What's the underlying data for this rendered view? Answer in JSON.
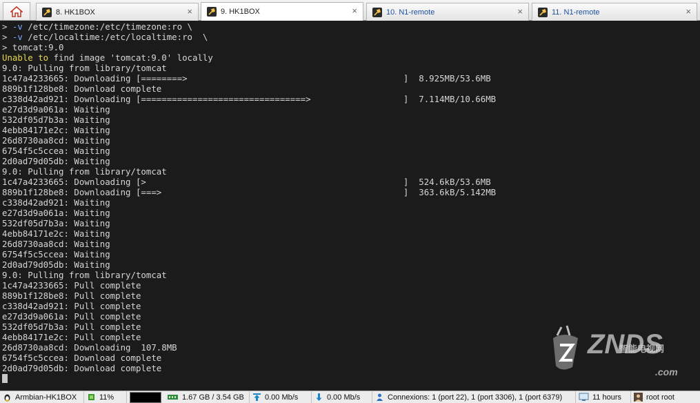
{
  "tabs": [
    {
      "label": "8. HK1BOX"
    },
    {
      "label": "9. HK1BOX"
    },
    {
      "label": "10. N1-remote"
    },
    {
      "label": "11. N1-remote"
    }
  ],
  "terminal": {
    "lines": [
      "> -v /etc/timezone:/etc/timezone:ro \\",
      "> -v /etc/localtime:/etc/localtime:ro  \\",
      "> tomcat:9.0",
      "Unable to find image 'tomcat:9.0' locally",
      "9.0: Pulling from library/tomcat",
      "1c47a4233665: Downloading [========>                                          ]  8.925MB/53.6MB",
      "889b1f128be8: Download complete",
      "c338d42ad921: Downloading [================================>                  ]  7.114MB/10.66MB",
      "e27d3d9a061a: Waiting",
      "532df05d7b3a: Waiting",
      "4ebb84171e2c: Waiting",
      "26d8730aa8cd: Waiting",
      "6754f5c5ccea: Waiting",
      "2d0ad79d05db: Waiting",
      "9.0: Pulling from library/tomcat",
      "1c47a4233665: Downloading [>                                                  ]  524.6kB/53.6MB",
      "889b1f128be8: Downloading [===>                                               ]  363.6kB/5.142MB",
      "c338d42ad921: Waiting",
      "e27d3d9a061a: Waiting",
      "532df05d7b3a: Waiting",
      "4ebb84171e2c: Waiting",
      "26d8730aa8cd: Waiting",
      "6754f5c5ccea: Waiting",
      "2d0ad79d05db: Waiting",
      "9.0: Pulling from library/tomcat",
      "1c47a4233665: Pull complete",
      "889b1f128be8: Pull complete",
      "c338d42ad921: Pull complete",
      "e27d3d9a061a: Pull complete",
      "532df05d7b3a: Pull complete",
      "4ebb84171e2c: Pull complete",
      "26d8730aa8cd: Downloading  107.8MB",
      "6754f5c5ccea: Download complete",
      "2d0ad79d05db: Download complete"
    ]
  },
  "watermark": {
    "cn": "智能电视网",
    "brand": "ZNDS",
    "suffix": ".com"
  },
  "statusbar": {
    "host": "Armbian-HK1BOX",
    "cpu": "11%",
    "memory": "1.67 GB / 3.54 GB",
    "upload": "0.00 Mb/s",
    "download": "0.00 Mb/s",
    "connections": "Connexions: 1 (port 22), 1 (port 3306), 1 (port 6379)",
    "uptime": "11 hours",
    "user": "root  root"
  },
  "colors": {
    "terminal_bg": "#1b1b1b",
    "terminal_fg": "#d6d6d6",
    "highlight": "#e8d84a",
    "remote_tab": "#1a4e9c"
  },
  "icons": {
    "home": "home-icon",
    "tab": "terminal-tool-icon",
    "linux": "tux-icon",
    "cpu": "cpu-icon",
    "memory": "ram-icon",
    "upload": "upload-arrow-icon",
    "download": "download-arrow-icon",
    "connections": "network-user-icon",
    "uptime": "monitor-icon",
    "user": "user-icon"
  }
}
